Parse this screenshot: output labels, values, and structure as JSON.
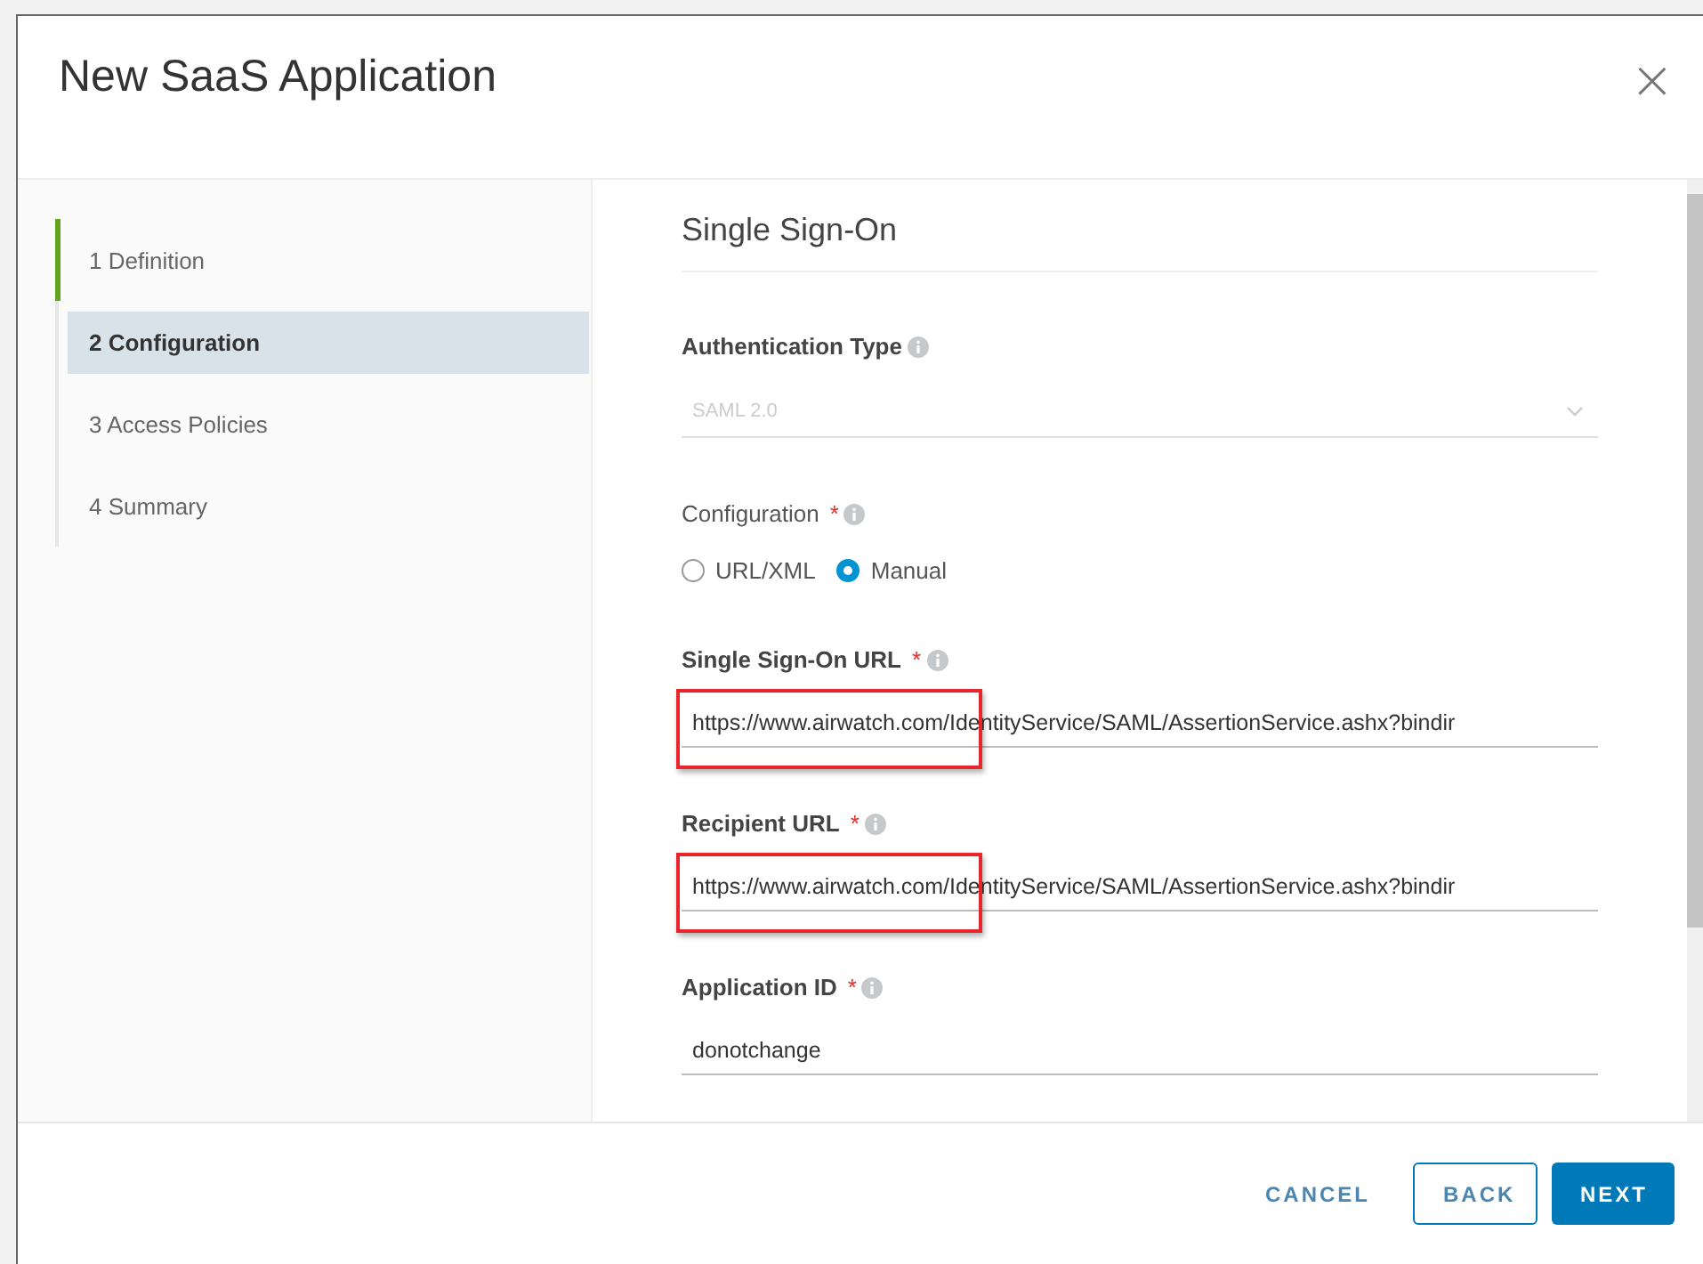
{
  "dialog": {
    "title": "New SaaS Application",
    "close": "×"
  },
  "steps": [
    {
      "label": "1  Definition",
      "selected": false,
      "completed": true
    },
    {
      "label": "2  Configuration",
      "selected": true,
      "completed": false
    },
    {
      "label": "3  Access Policies",
      "selected": false,
      "completed": false
    },
    {
      "label": "4  Summary",
      "selected": false,
      "completed": false
    }
  ],
  "section_title": "Single Sign-On",
  "required_mark": "*",
  "fields": [
    {
      "kind": "select",
      "label": "Authentication Type",
      "bold": true,
      "required": false,
      "value": "SAML 2.0",
      "disabled": true
    },
    {
      "kind": "radio",
      "label": "Configuration",
      "bold": false,
      "required": true,
      "options": [
        {
          "label": "URL/XML",
          "selected": false
        },
        {
          "label": "Manual",
          "selected": true
        }
      ]
    },
    {
      "kind": "text",
      "label": "Single Sign-On URL",
      "bold": true,
      "required": true,
      "value": "https://www.airwatch.com/IdentityService/SAML/AssertionService.ashx?bindir",
      "highlighted": true
    },
    {
      "kind": "text",
      "label": "Recipient URL",
      "bold": true,
      "required": true,
      "value": "https://www.airwatch.com/IdentityService/SAML/AssertionService.ashx?bindir",
      "highlighted": true
    },
    {
      "kind": "text",
      "label": "Application ID",
      "bold": true,
      "required": true,
      "value": "donotchange",
      "highlighted": false
    }
  ],
  "buttons": [
    {
      "label": "CANCEL",
      "kind": "flat"
    },
    {
      "label": "BACK",
      "kind": "outline"
    },
    {
      "label": "NEXT",
      "kind": "primary"
    }
  ]
}
